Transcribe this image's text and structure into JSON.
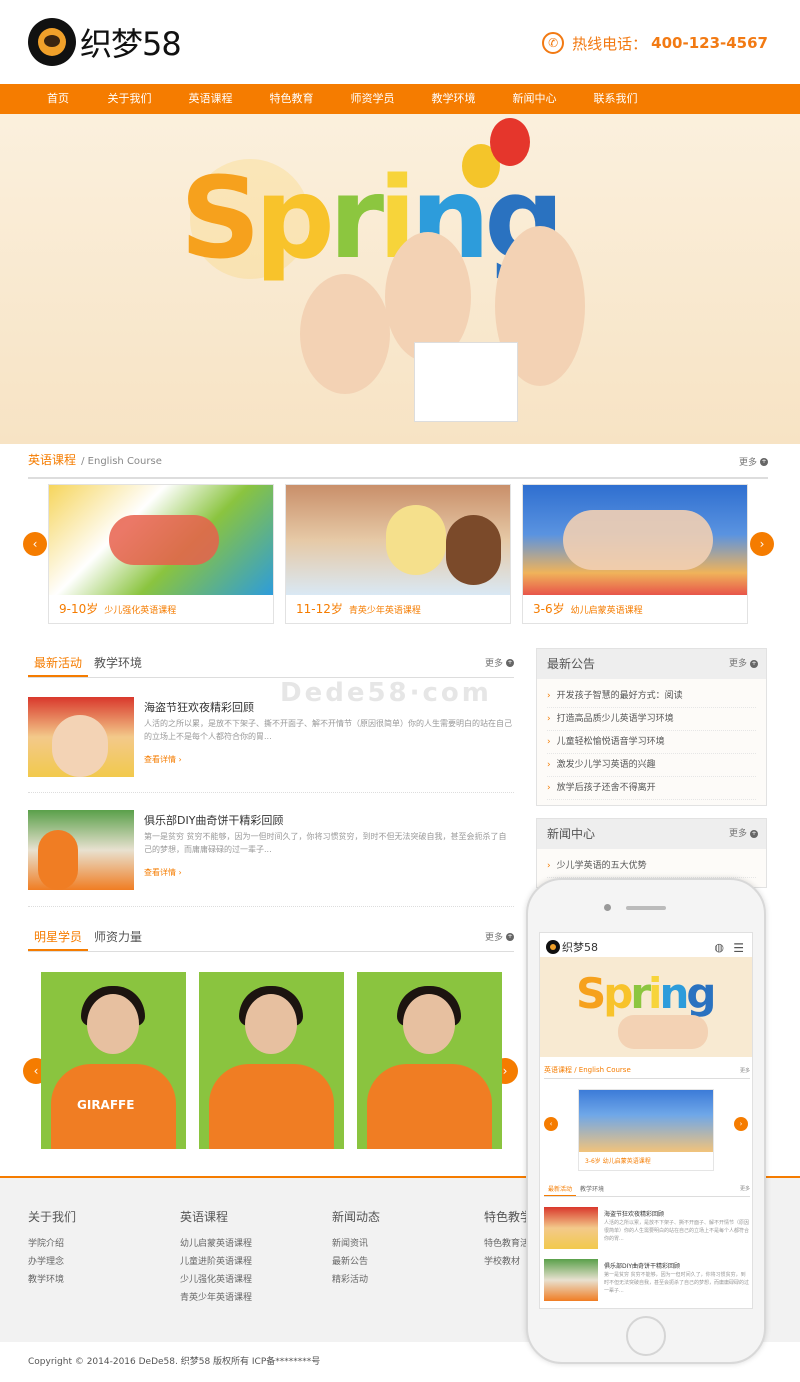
{
  "header": {
    "logo_text": "织梦58",
    "hotline_label": "热线电话：",
    "hotline_number": "400-123-4567"
  },
  "nav": {
    "items": [
      "首页",
      "关于我们",
      "英语课程",
      "特色教育",
      "师资学员",
      "教学环境",
      "新闻中心",
      "联系我们"
    ]
  },
  "banner": {
    "word": [
      "S",
      "p",
      "r",
      "i",
      "n",
      "g"
    ]
  },
  "courses": {
    "title": "英语课程",
    "subtitle": "/ English Course",
    "more": "更多",
    "items": [
      {
        "age": "9-10岁",
        "name": "少儿强化英语课程"
      },
      {
        "age": "11-12岁",
        "name": "青英少年英语课程"
      },
      {
        "age": "3-6岁",
        "name": "幼儿启蒙英语课程"
      }
    ]
  },
  "activities": {
    "tabs": [
      "最新活动",
      "教学环境"
    ],
    "more": "更多",
    "items": [
      {
        "title": "海盗节狂欢夜精彩回顾",
        "desc": "人活的之所以累，是放不下架子、撕不开面子、解不开情节（原因很简单）你的人生需要明白的站在自己的立场上不是每个人都符合你的胃...",
        "link": "查看详情 ›"
      },
      {
        "title": "俱乐部DIY曲奇饼干精彩回顾",
        "desc": "第一是贫穷 贫穷不能够，因为一但时间久了，你将习惯贫穷，到时不但无法突破自我，甚至会扼杀了自己的梦想，而庸庸碌碌的过一辈子...",
        "link": "查看详情 ›"
      }
    ]
  },
  "watermark": "Dede58·com",
  "notices": {
    "title": "最新公告",
    "more": "更多",
    "items": [
      "开发孩子智慧的最好方式：阅读",
      "打造高品质少儿英语学习环境",
      "儿童轻松愉悦语音学习环境",
      "激发少儿学习英语的兴趣",
      "放学后孩子还舍不得离开"
    ]
  },
  "news_center": {
    "title": "新闻中心",
    "more": "更多",
    "items": [
      "少儿学英语的五大优势"
    ]
  },
  "stars": {
    "tabs": [
      "明星学员",
      "师资力量"
    ],
    "more": "更多",
    "shirt_text": "GIRAFFE"
  },
  "footer": {
    "cols": [
      {
        "title": "关于我们",
        "links": [
          "学院介绍",
          "办学理念",
          "教学环境"
        ]
      },
      {
        "title": "英语课程",
        "links": [
          "幼儿启蒙英语课程",
          "儿童进阶英语课程",
          "少儿强化英语课程",
          "青英少年英语课程"
        ]
      },
      {
        "title": "新闻动态",
        "links": [
          "新闻资讯",
          "最新公告",
          "精彩活动"
        ]
      },
      {
        "title": "特色教学",
        "links": [
          "特色教育活",
          "学校教材"
        ]
      }
    ],
    "copyright": "Copyright © 2014-2016 DeDe58. 织梦58 版权所有    ICP备********号"
  },
  "phone": {
    "logo_text": "织梦58",
    "section_title": "英语课程 / English Course",
    "more": "更多",
    "card": {
      "age": "3-6岁",
      "name": "幼儿启蒙英语课程"
    },
    "tabs": [
      "最新活动",
      "教学环境"
    ],
    "news": [
      {
        "title": "海盗节狂欢夜精彩回顾",
        "desc": "人活的之所以累，是放不下架子、撕不开面子、解不开情节（原因很简单）你的人生需要明白的站在自己的立场上不是每个人都符合你的胃..."
      },
      {
        "title": "俱乐部DIY曲奇饼干精彩回顾",
        "desc": "第一是贫穷 贫穷不能够，因为一但时间久了，你将习惯贫穷，到时不但无法突破自我，甚至会扼杀了自己的梦想，而庸庸碌碌的过一辈子..."
      }
    ]
  },
  "colors": {
    "accent": "#f57c00",
    "footer_bg": "#f2f2f2"
  }
}
